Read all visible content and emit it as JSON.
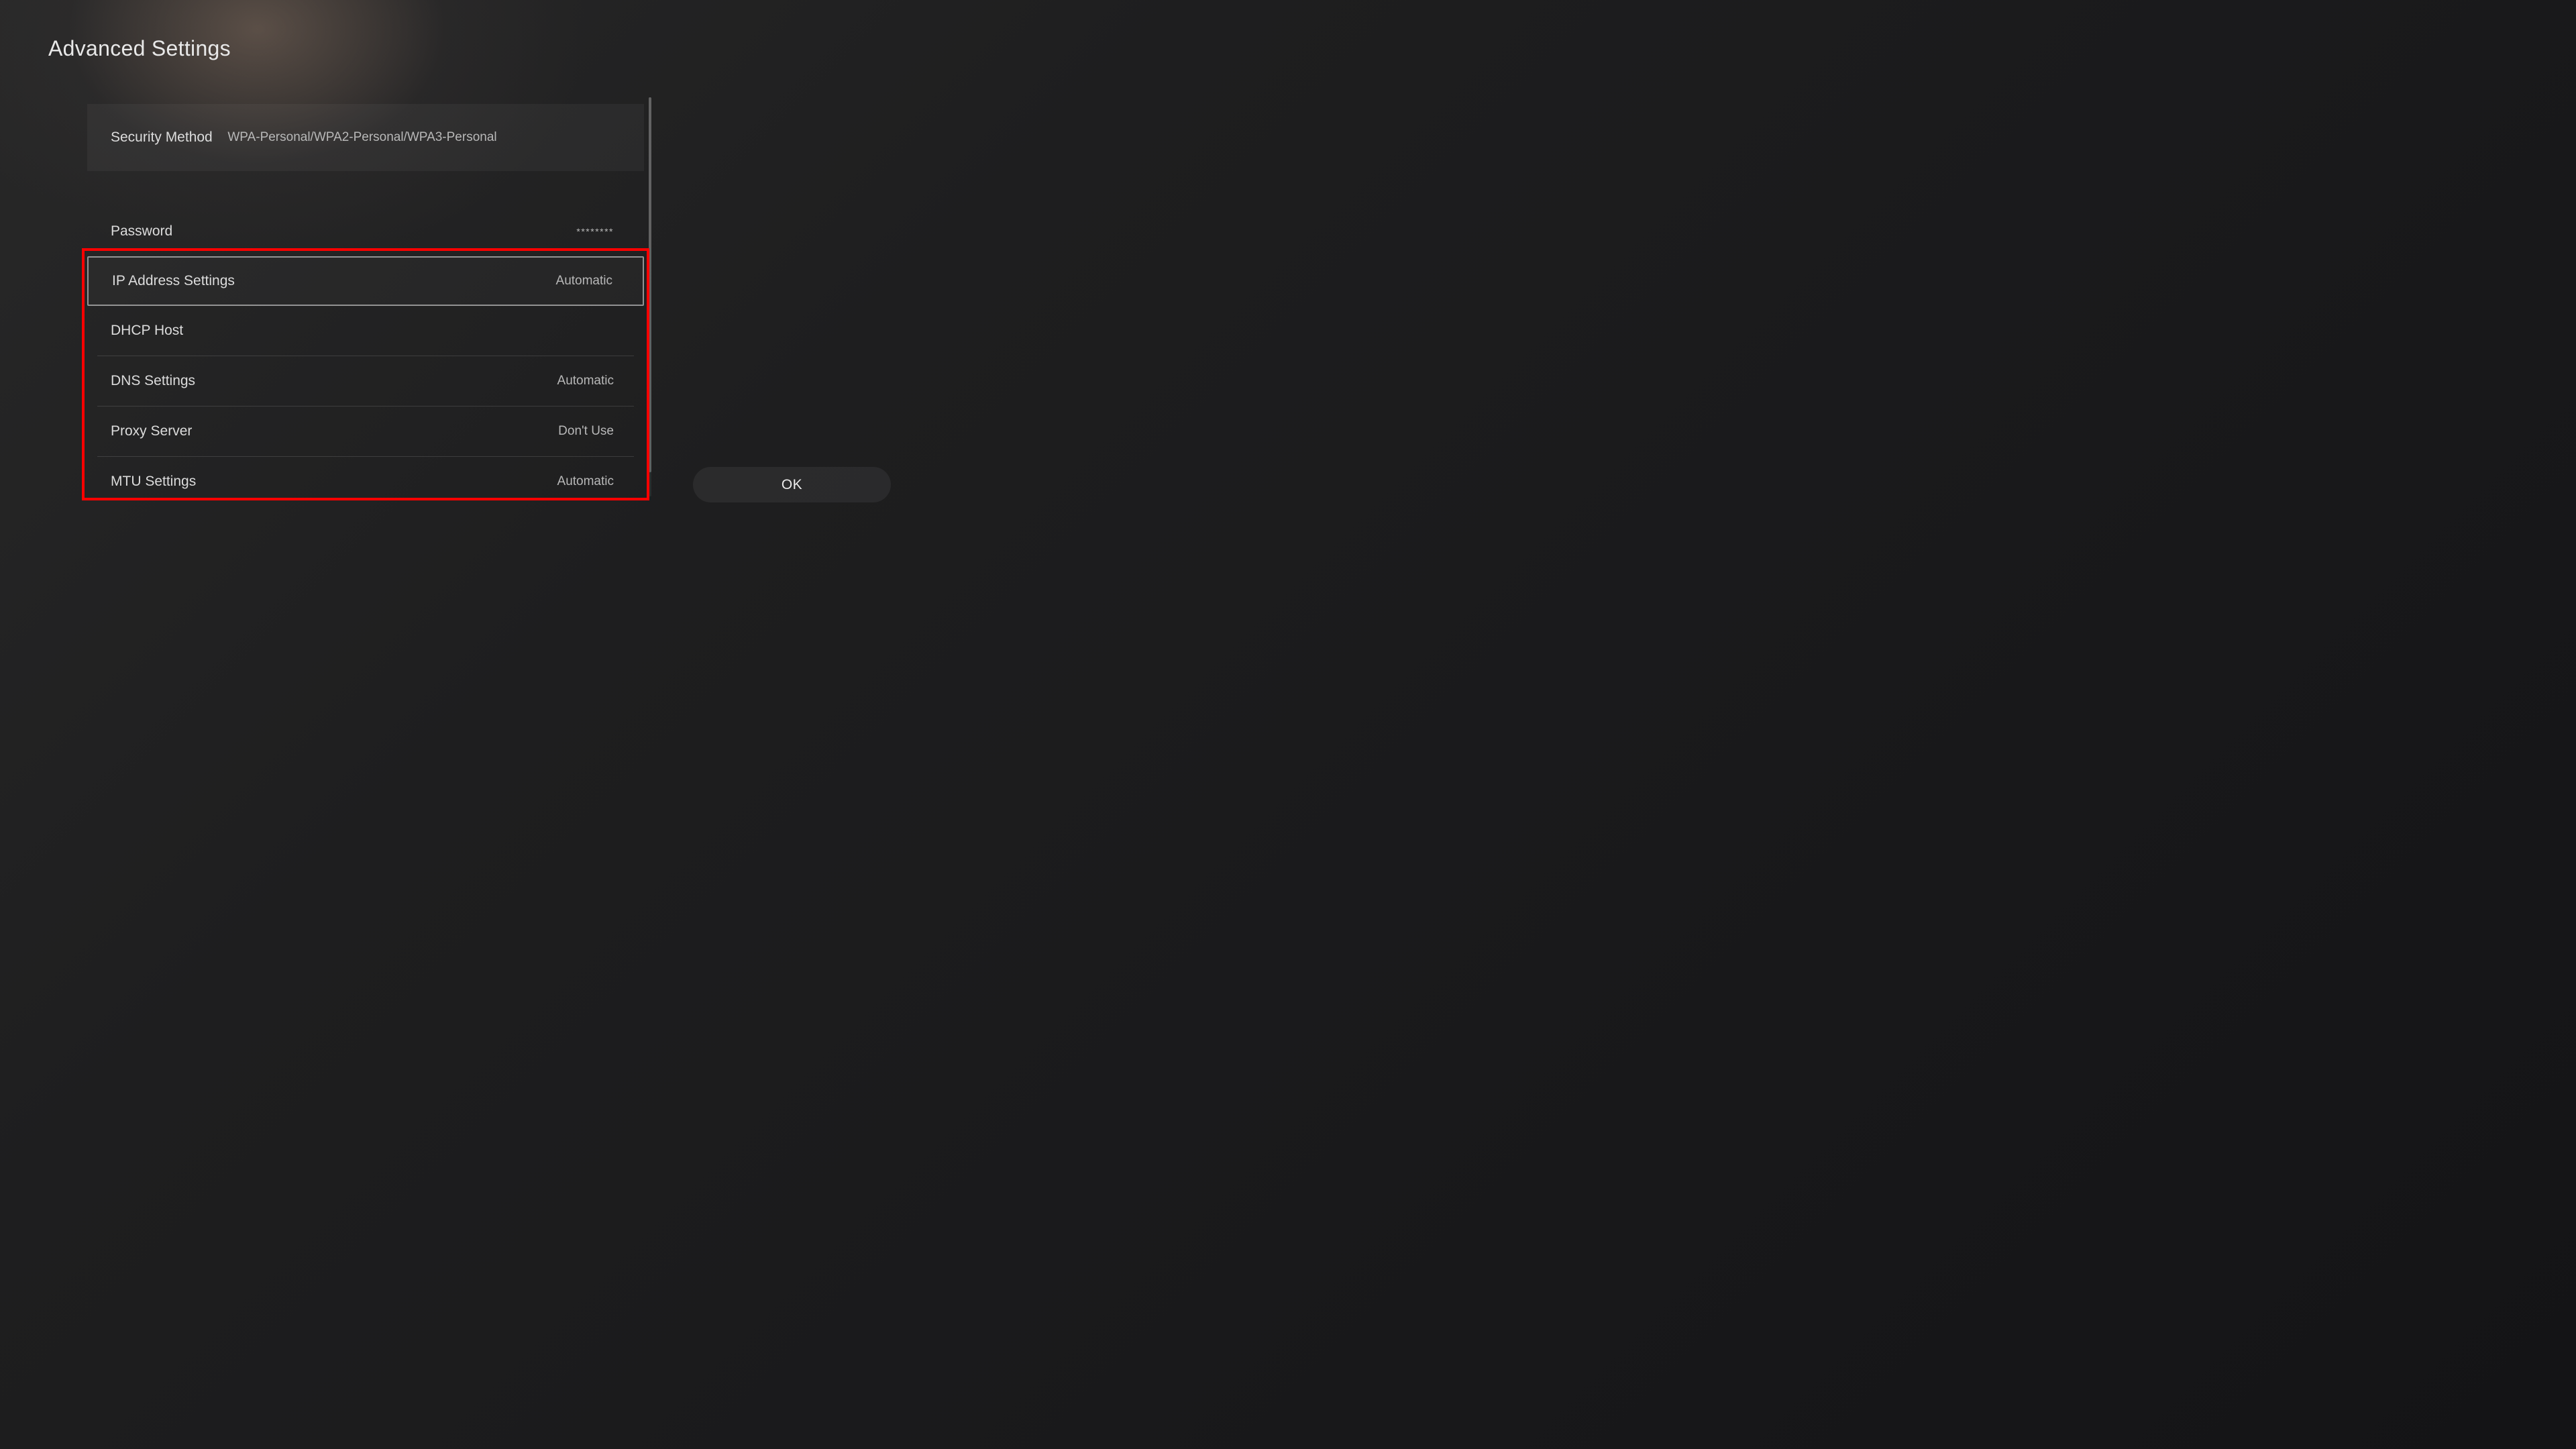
{
  "header": {
    "title": "Advanced Settings"
  },
  "settings": {
    "security_method": {
      "label": "Security Method",
      "value": "WPA-Personal/WPA2-Personal/WPA3-Personal"
    },
    "password": {
      "label": "Password",
      "value": "********"
    },
    "ip_address": {
      "label": "IP Address Settings",
      "value": "Automatic"
    },
    "dhcp_host": {
      "label": "DHCP Host",
      "value": ""
    },
    "dns_settings": {
      "label": "DNS Settings",
      "value": "Automatic"
    },
    "proxy_server": {
      "label": "Proxy Server",
      "value": "Don't Use"
    },
    "mtu_settings": {
      "label": "MTU Settings",
      "value": "Automatic"
    }
  },
  "actions": {
    "ok_label": "OK"
  }
}
